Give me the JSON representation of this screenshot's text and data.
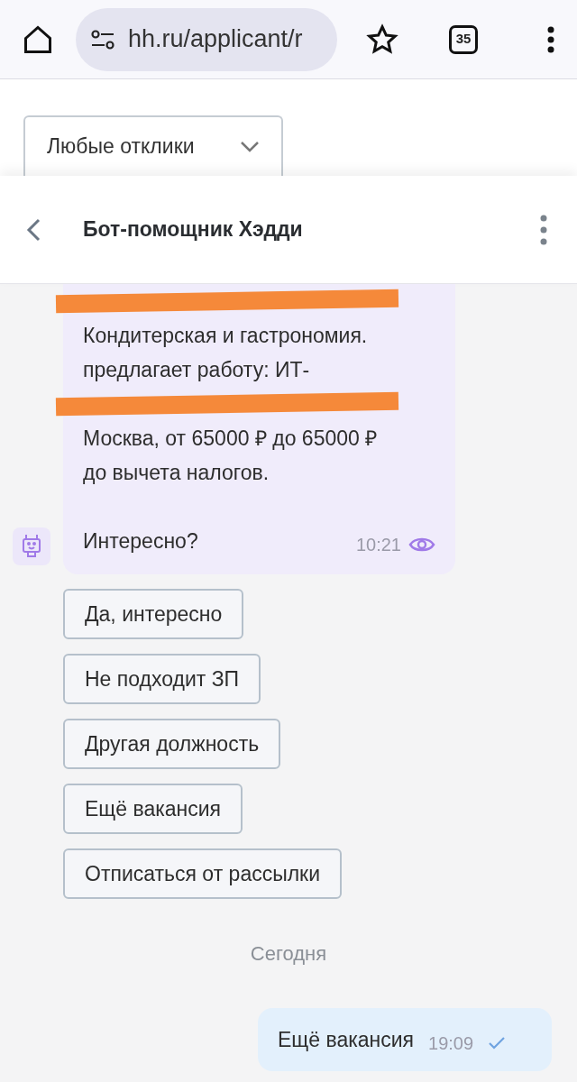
{
  "browser": {
    "url": "hh.ru/applicant/r",
    "tab_count": "35"
  },
  "filter": {
    "value": "Любые отклики"
  },
  "chat": {
    "title": "Бот-помощник Хэдди",
    "message": {
      "parts": [
        {
          "kind": "redacted"
        },
        {
          "kind": "text",
          "text": "Кондитерская и гастрономия."
        },
        {
          "kind": "text",
          "text": "предлагает работу: ИТ-"
        },
        {
          "kind": "redacted"
        },
        {
          "kind": "text",
          "text": "Москва, от 65000 ₽ до 65000 ₽"
        },
        {
          "kind": "text",
          "text": "до вычета налогов."
        },
        {
          "kind": "blank"
        },
        {
          "kind": "text",
          "text": "Интересно?"
        }
      ],
      "time": "10:21",
      "seen": true
    },
    "quick_replies": [
      "Да, интересно",
      "Не подходит ЗП",
      "Другая должность",
      "Ещё вакансия",
      "Отписаться от рассылки"
    ],
    "date_divider": "Сегодня",
    "reply": {
      "text": "Ещё вакансия",
      "time": "19:09",
      "delivered": true
    }
  }
}
